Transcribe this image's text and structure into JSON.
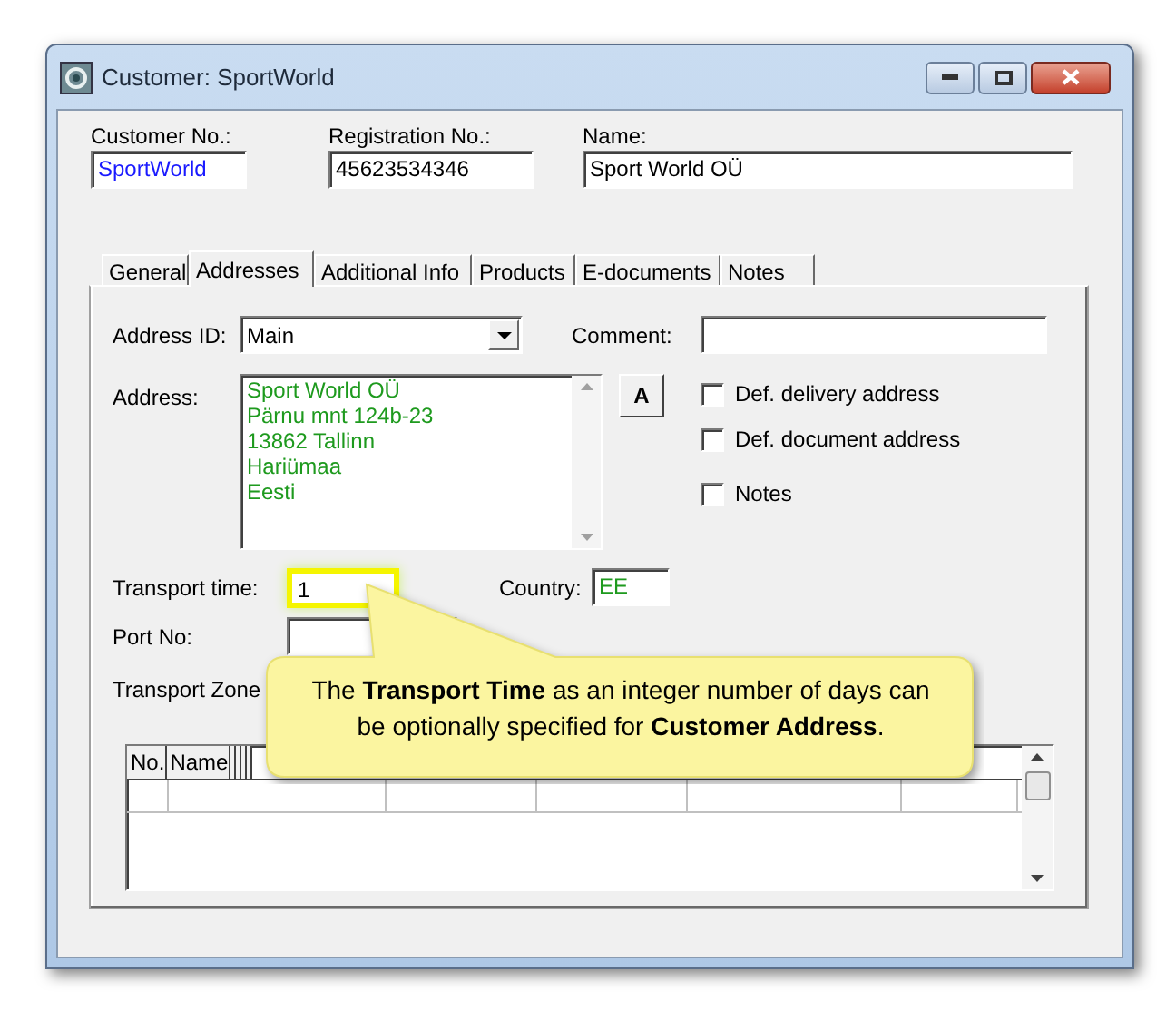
{
  "window": {
    "title": "Customer: SportWorld"
  },
  "header_fields": [
    {
      "label": "Customer No.:",
      "value": "SportWorld",
      "kind": "key"
    },
    {
      "label": "Registration No.:",
      "value": "45623534346",
      "kind": "text"
    },
    {
      "label": "Name:",
      "value": "Sport World OÜ",
      "kind": "text"
    }
  ],
  "tabs": [
    {
      "label": "General",
      "selected": false
    },
    {
      "label": "Addresses",
      "selected": true
    },
    {
      "label": "Additional Info",
      "selected": false
    },
    {
      "label": "Products",
      "selected": false
    },
    {
      "label": "E-documents",
      "selected": false
    },
    {
      "label": "Notes",
      "selected": false
    }
  ],
  "address_id": {
    "label": "Address ID:",
    "value": "Main"
  },
  "comment": {
    "label": "Comment:"
  },
  "address": {
    "label": "Address:",
    "lines": [
      "Sport World OÜ",
      "Pärnu mnt 124b-23",
      "13862 Tallinn",
      "Hariümaa",
      "Eesti"
    ]
  },
  "format_button": "A",
  "checkboxes": [
    {
      "label": "Def. delivery address",
      "checked": false
    },
    {
      "label": "Def. document address",
      "checked": false
    },
    {
      "label": "Notes",
      "checked": false
    }
  ],
  "transport_time": {
    "label": "Transport time:",
    "value": "1",
    "highlighted": true
  },
  "country": {
    "label": "Country:",
    "value": "EE"
  },
  "port_no": {
    "label": "Port No:"
  },
  "transport_zone": {
    "label": "Transport Zone"
  },
  "contacts_table": {
    "columns": [
      "No.",
      "Name"
    ]
  },
  "callout": {
    "text": "The **Transport Time** as an integer number of days can be optionally specified for **Customer Address**."
  }
}
